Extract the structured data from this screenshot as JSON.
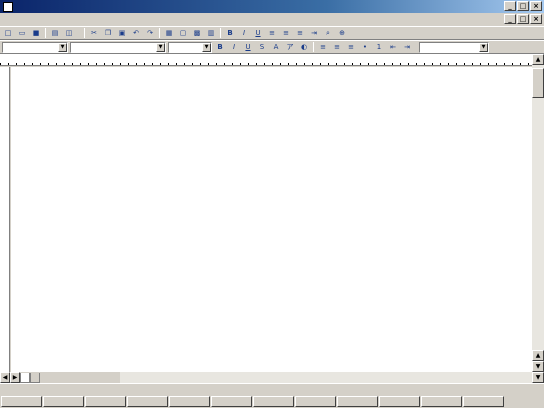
{
  "window": {
    "title": "",
    "minimize": "_",
    "maximize": "□",
    "close": "×"
  },
  "menubar": {
    "items": [
      "",
      "",
      "",
      "",
      "",
      "",
      "",
      "",
      "",
      ""
    ]
  },
  "toolbar1": {
    "vertical_text_label": ""
  },
  "toolbar2": {
    "style": "",
    "font": "",
    "size": "",
    "right_dropdown": ""
  },
  "document": {
    "columns": [
      "",
      "",
      "",
      "",
      "",
      "",
      "",
      "",
      "",
      "",
      "",
      "",
      "",
      "",
      "",
      "",
      "",
      "",
      "",
      "",
      "",
      "",
      "",
      "",
      "",
      "",
      "",
      ""
    ]
  },
  "tabs": {
    "active": "",
    "other": "",
    "position": ""
  },
  "statusbar": {
    "mode": "",
    "font_info": ""
  },
  "function_keys": [
    "",
    "",
    "",
    "",
    "",
    "",
    "",
    "",
    "",
    "",
    "",
    ""
  ]
}
